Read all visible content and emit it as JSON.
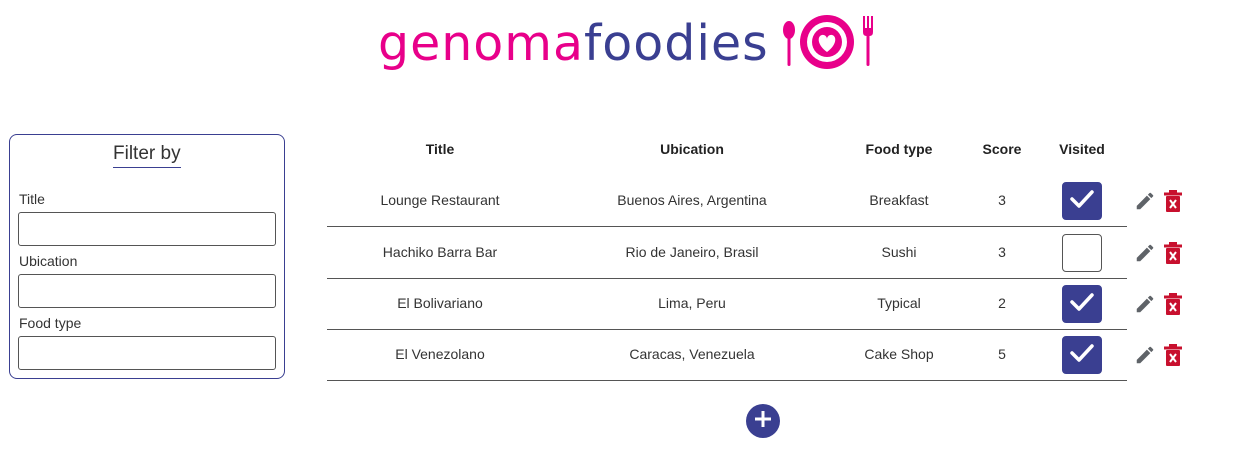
{
  "brand": {
    "part1": "genoma",
    "part2": "foodies",
    "color_pink": "#e8008a",
    "color_navy": "#3a3f91"
  },
  "filter": {
    "title": "Filter by",
    "fields": [
      {
        "label": "Title",
        "value": ""
      },
      {
        "label": "Ubication",
        "value": ""
      },
      {
        "label": "Food type",
        "value": ""
      }
    ]
  },
  "table": {
    "headers": {
      "title": "Title",
      "ubication": "Ubication",
      "food_type": "Food type",
      "score": "Score",
      "visited": "Visited"
    },
    "rows": [
      {
        "title": "Lounge Restaurant",
        "ubication": "Buenos Aires, Argentina",
        "food_type": "Breakfast",
        "score": "3",
        "visited": true
      },
      {
        "title": "Hachiko Barra Bar",
        "ubication": "Rio de Janeiro, Brasil",
        "food_type": "Sushi",
        "score": "3",
        "visited": false
      },
      {
        "title": "El Bolivariano",
        "ubication": "Lima, Peru",
        "food_type": "Typical",
        "score": "2",
        "visited": true
      },
      {
        "title": "El Venezolano",
        "ubication": "Caracas, Venezuela",
        "food_type": "Cake Shop",
        "score": "5",
        "visited": true
      }
    ]
  },
  "icons": {
    "edit": "pencil-icon",
    "delete": "trash-icon",
    "add": "plus-icon",
    "logo": "plate-heart-icon"
  },
  "colors": {
    "delete_red": "#c8102e",
    "edit_gray": "#5f6368"
  }
}
